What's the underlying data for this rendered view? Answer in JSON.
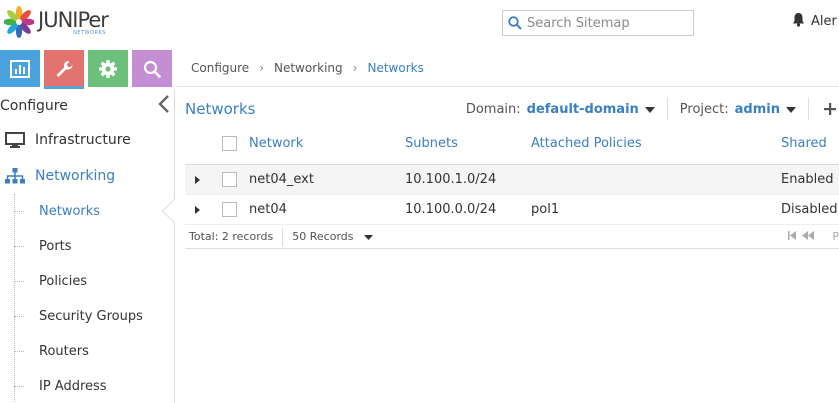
{
  "brand": {
    "name": "JUNIPer",
    "sub": "NETWORKS"
  },
  "search": {
    "placeholder": "Search Sitemap"
  },
  "user": {
    "name": "Aler"
  },
  "icon_tabs": [
    {
      "name": "monitor-tab",
      "icon": "bar-chart-icon",
      "color": "#4aa3df",
      "active": false
    },
    {
      "name": "configure-tab",
      "icon": "wrench-icon",
      "color": "#e3736f",
      "active": true
    },
    {
      "name": "settings-tab",
      "icon": "gear-icon",
      "color": "#6cc07b",
      "active": false
    },
    {
      "name": "query-tab",
      "icon": "search-icon",
      "color": "#c38ed4",
      "active": false
    }
  ],
  "sidebar": {
    "title": "Configure",
    "groups": [
      {
        "label": "Infrastructure",
        "icon": "monitor-icon",
        "active": false
      },
      {
        "label": "Networking",
        "icon": "sitemap-icon",
        "active": true
      }
    ],
    "items": [
      {
        "label": "Networks",
        "active": true
      },
      {
        "label": "Ports",
        "active": false
      },
      {
        "label": "Policies",
        "active": false
      },
      {
        "label": "Security Groups",
        "active": false
      },
      {
        "label": "Routers",
        "active": false
      },
      {
        "label": "IP Address",
        "active": false
      }
    ]
  },
  "breadcrumb": [
    "Configure",
    "Networking",
    "Networks"
  ],
  "panel": {
    "title": "Networks",
    "domain_label": "Domain:",
    "domain_value": "default-domain",
    "project_label": "Project:",
    "project_value": "admin"
  },
  "table": {
    "columns": [
      "Network",
      "Subnets",
      "Attached Policies",
      "Shared"
    ],
    "rows": [
      {
        "network": "net04_ext",
        "subnets": "10.100.1.0/24",
        "policies": "",
        "shared": "Enabled"
      },
      {
        "network": "net04",
        "subnets": "10.100.0.0/24",
        "policies": "pol1",
        "shared": "Disabled"
      }
    ],
    "total": "Total: 2 records",
    "page_size": "50 Records",
    "page_label": "P"
  },
  "colors": {
    "accent": "#3a7fc1",
    "active_tab_underline": "#5b9fd6"
  }
}
